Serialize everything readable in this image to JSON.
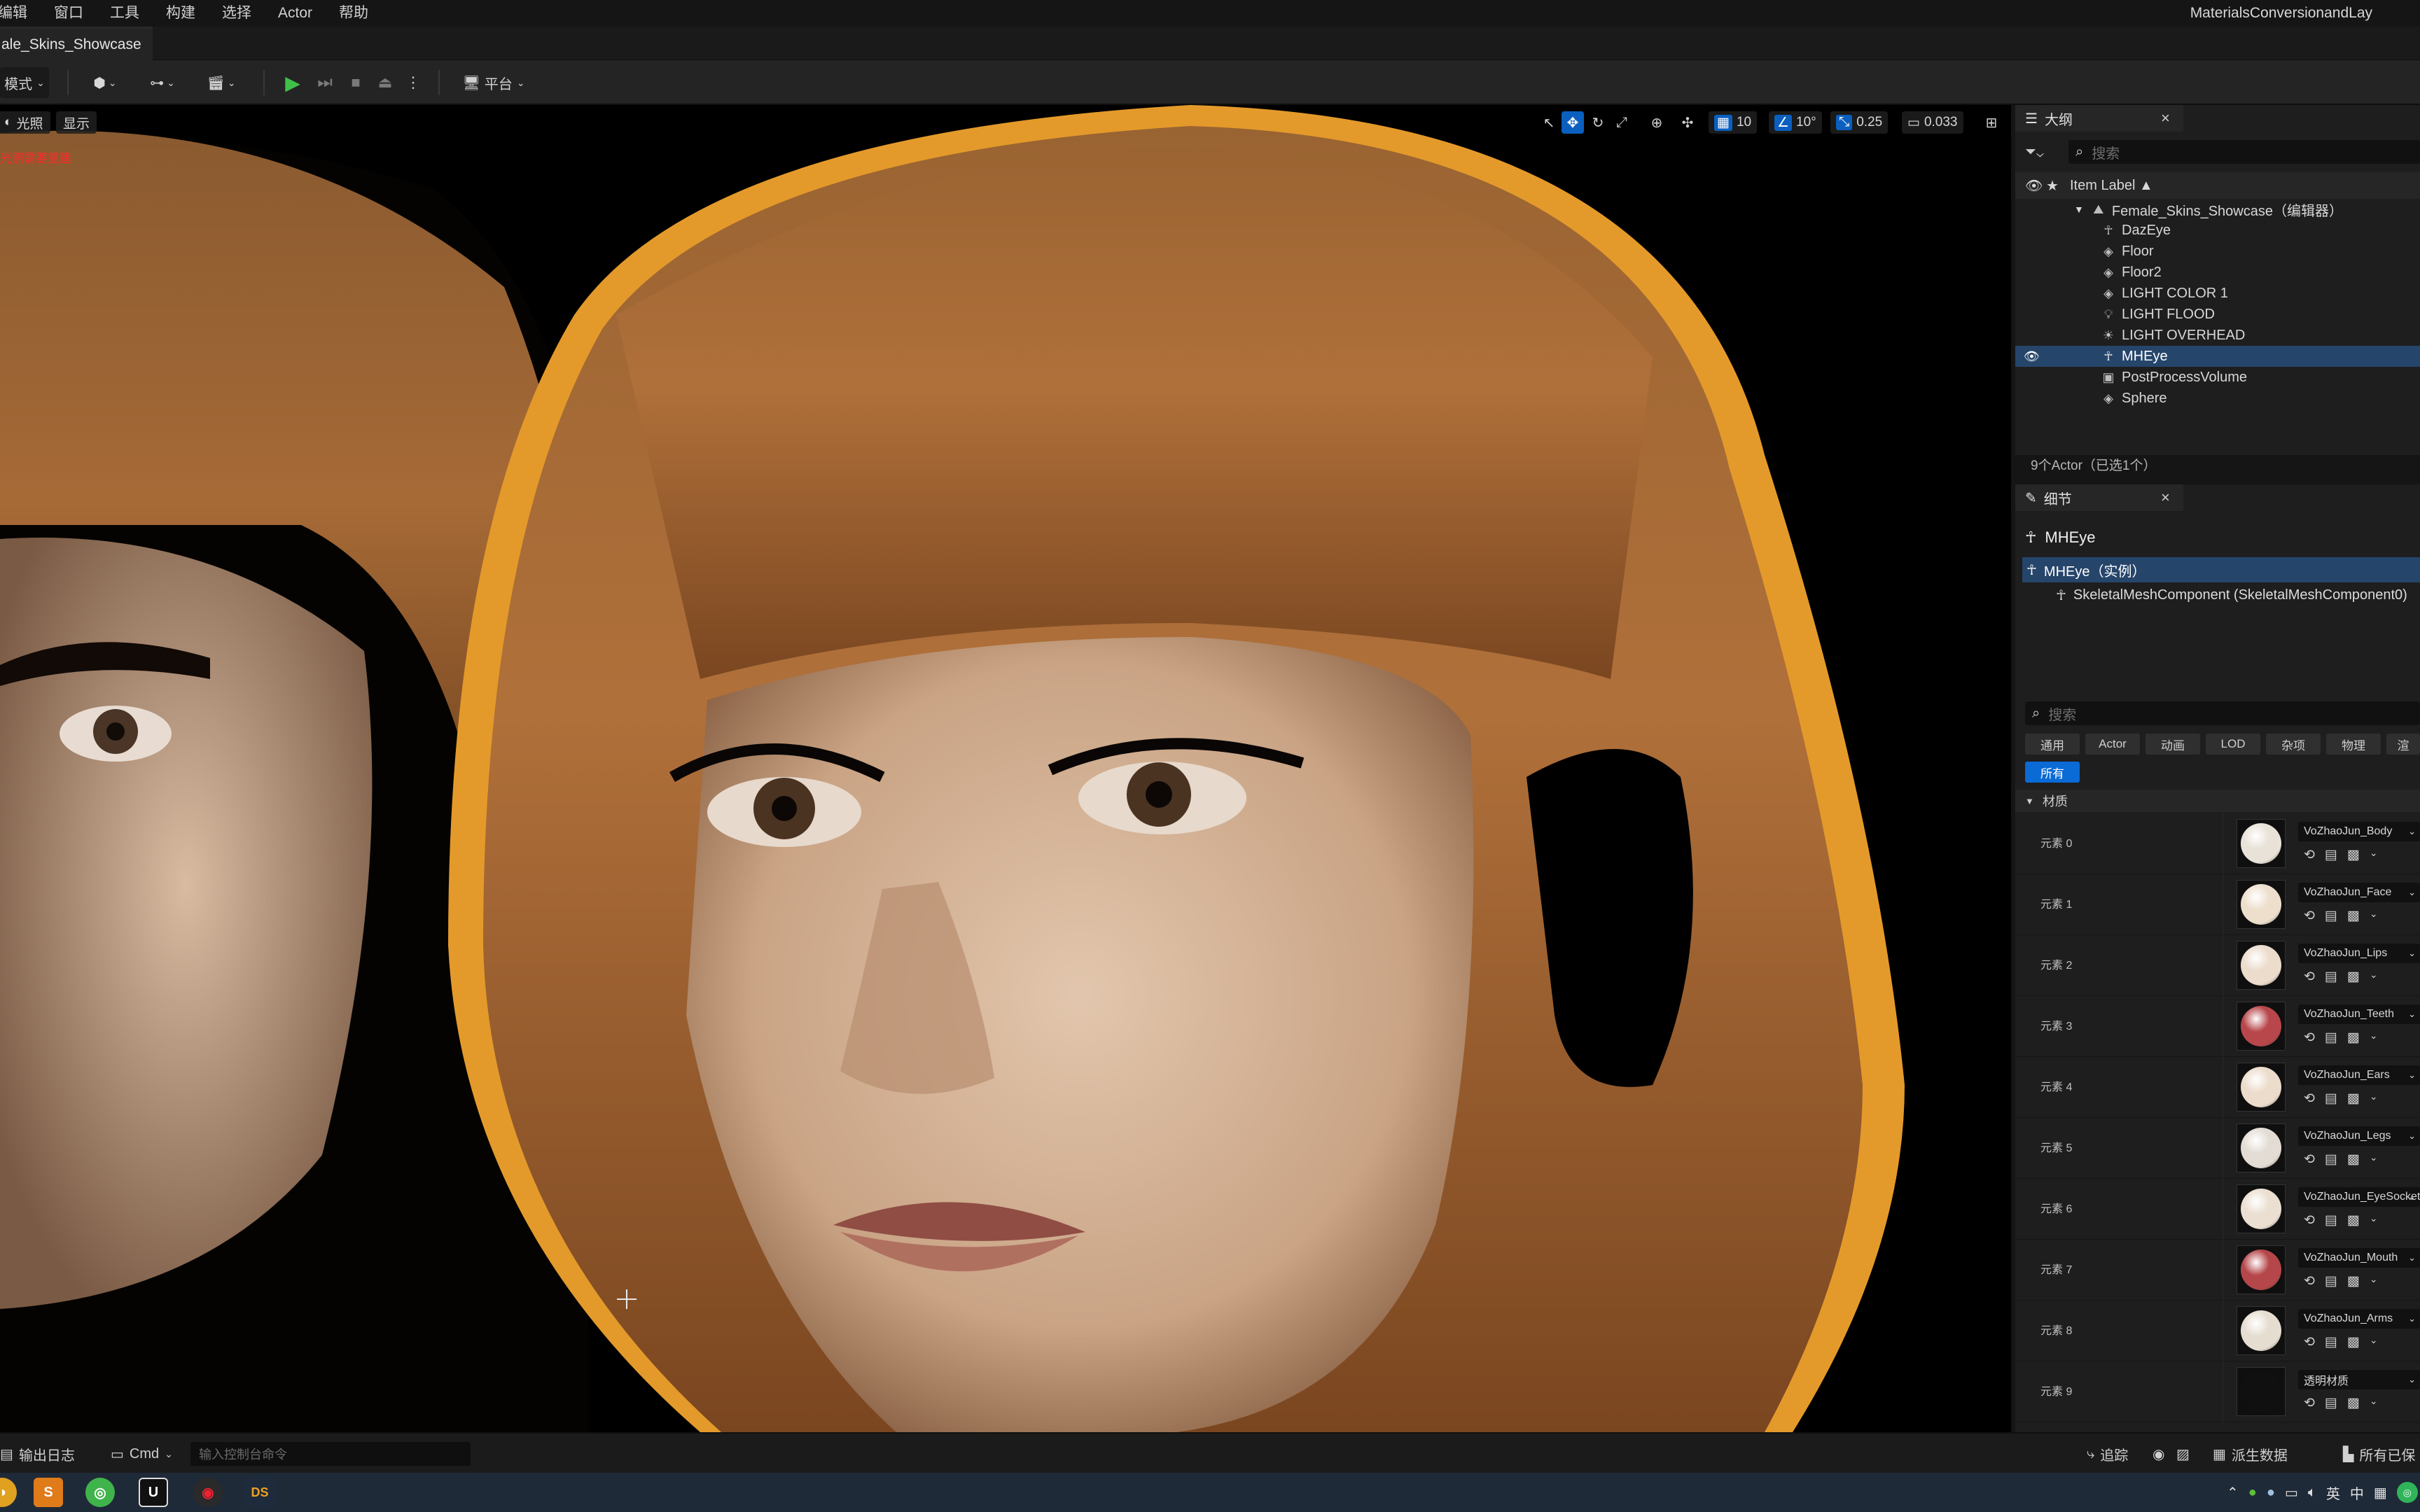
{
  "menubar": {
    "items": [
      "编辑",
      "窗口",
      "工具",
      "构建",
      "选择",
      "Actor",
      "帮助"
    ],
    "project_name": "MaterialsConversionandLay"
  },
  "document_tab": {
    "label": "ale_Skins_Showcase"
  },
  "toolbar": {
    "mode_label": "模式",
    "platform_label": "平台"
  },
  "viewport": {
    "lit_label": "光照",
    "show_label": "显示",
    "warning_text": "光照需要重建",
    "grid_snap": "10",
    "rotation_snap": "10°",
    "scale_snap": "0.25",
    "camera_speed": "0.033"
  },
  "outliner": {
    "tab_label": "大纲",
    "search_placeholder": "搜索",
    "column_label": "Item Label ▲",
    "root_item": "Female_Skins_Showcase（编辑器）",
    "items": [
      "DazEye",
      "Floor",
      "Floor2",
      "LIGHT COLOR 1",
      "LIGHT FLOOD",
      "LIGHT OVERHEAD",
      "MHEye",
      "PostProcessVolume",
      "Sphere"
    ],
    "selected_item": "MHEye",
    "status": "9个Actor（已选1个）"
  },
  "details": {
    "tab_label": "细节",
    "actor_name": "MHEye",
    "instance_label": "MHEye（实例）",
    "component_label": "SkeletalMeshComponent (SkeletalMeshComponent0)",
    "search_placeholder": "搜索",
    "categories": [
      "通用",
      "Actor",
      "动画",
      "LOD",
      "杂项",
      "物理",
      "渲"
    ],
    "all_label": "所有",
    "section_label": "材质",
    "materials": [
      {
        "label": "元素 0",
        "material": "VoZhaoJun_Body",
        "color": "#e9e2d8"
      },
      {
        "label": "元素 1",
        "material": "VoZhaoJun_Face",
        "color": "#eedfcd"
      },
      {
        "label": "元素 2",
        "material": "VoZhaoJun_Lips",
        "color": "#ecdccc"
      },
      {
        "label": "元素 3",
        "material": "VoZhaoJun_Teeth",
        "color": "#b8474b"
      },
      {
        "label": "元素 4",
        "material": "VoZhaoJun_Ears",
        "color": "#ecdccb"
      },
      {
        "label": "元素 5",
        "material": "VoZhaoJun_Legs",
        "color": "#e3dcd4"
      },
      {
        "label": "元素 6",
        "material": "VoZhaoJun_EyeSocket",
        "color": "#ebdfd1"
      },
      {
        "label": "元素 7",
        "material": "VoZhaoJun_Mouth",
        "color": "#b5474a"
      },
      {
        "label": "元素 8",
        "material": "VoZhaoJun_Arms",
        "color": "#e6ddd1"
      },
      {
        "label": "元素 9",
        "material": "透明材质",
        "color": "#101010"
      }
    ]
  },
  "bottombar": {
    "output_log": "输出日志",
    "cmd_label": "Cmd",
    "console_placeholder": "输入控制台命令",
    "trace_label": "追踪",
    "derived_data_label": "派生数据",
    "saved_label": "所有已保"
  },
  "taskbar": {
    "lang": "英",
    "ime": "中"
  }
}
